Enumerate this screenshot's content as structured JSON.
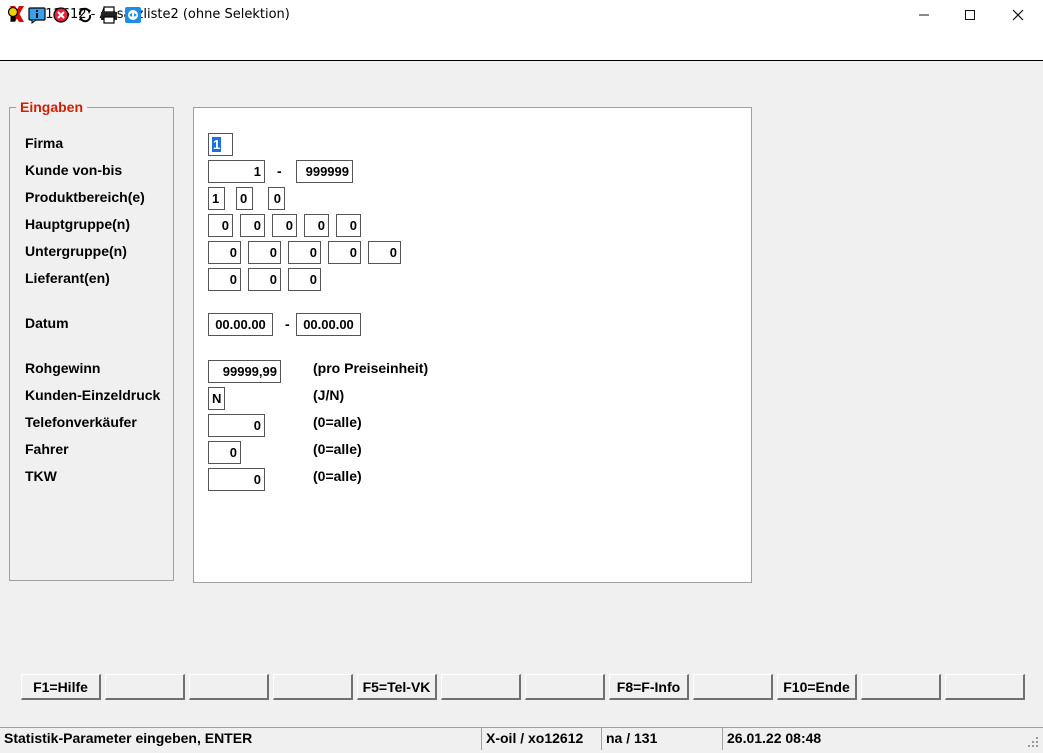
{
  "window": {
    "title": "xo12612 - Absatzliste2 (ohne Selektion)"
  },
  "toolbar": {
    "icons": [
      "lightbulb-icon",
      "info-icon",
      "cancel-icon",
      "refresh-icon",
      "print-icon",
      "remote-icon"
    ]
  },
  "group": {
    "legend": "Eingaben"
  },
  "labels": {
    "firma": "Firma",
    "kunde": "Kunde von-bis",
    "produktbereich": "Produktbereich(e)",
    "hauptgruppe": "Hauptgruppe(n)",
    "untergruppe": "Untergruppe(n)",
    "lieferant": "Lieferant(en)",
    "datum": "Datum",
    "rohgewinn": "Rohgewinn",
    "einzeldruck": "Kunden-Einzeldruck",
    "telefonverkaeufer": "Telefonverkäufer",
    "fahrer": "Fahrer",
    "tkw": "TKW"
  },
  "fields": {
    "firma": "1",
    "kunde_von": "1",
    "kunde_bis": "999999",
    "produktbereich": [
      "1",
      "0",
      "0"
    ],
    "hauptgruppe": [
      "0",
      "0",
      "0",
      "0",
      "0"
    ],
    "untergruppe": [
      "0",
      "0",
      "0",
      "0",
      "0"
    ],
    "lieferant": [
      "0",
      "0",
      "0"
    ],
    "datum_von": "00.00.00",
    "datum_bis": "00.00.00",
    "rohgewinn": "99999,99",
    "einzeldruck": "N",
    "telefonverkaeufer": "0",
    "fahrer": "0",
    "tkw": "0"
  },
  "separators": {
    "dash": "-"
  },
  "hints": {
    "rohgewinn": "(pro Preiseinheit)",
    "einzeldruck": "(J/N)",
    "telefonverkaeufer": "(0=alle)",
    "fahrer": "(0=alle)",
    "tkw": "(0=alle)"
  },
  "function_keys": [
    "F1=Hilfe",
    "",
    "",
    "",
    "F5=Tel-VK",
    "",
    "",
    "F8=F-Info",
    "",
    "F10=Ende",
    "",
    ""
  ],
  "status": {
    "message": "Statistik-Parameter eingeben, ENTER",
    "app": "X-oil / xo12612",
    "info": "na / 131",
    "datetime": "26.01.22 08:48"
  },
  "colors": {
    "accent": "#d02000",
    "selection": "#1e6fd9",
    "panel": "#ffffff",
    "background": "#f0f0f0"
  }
}
